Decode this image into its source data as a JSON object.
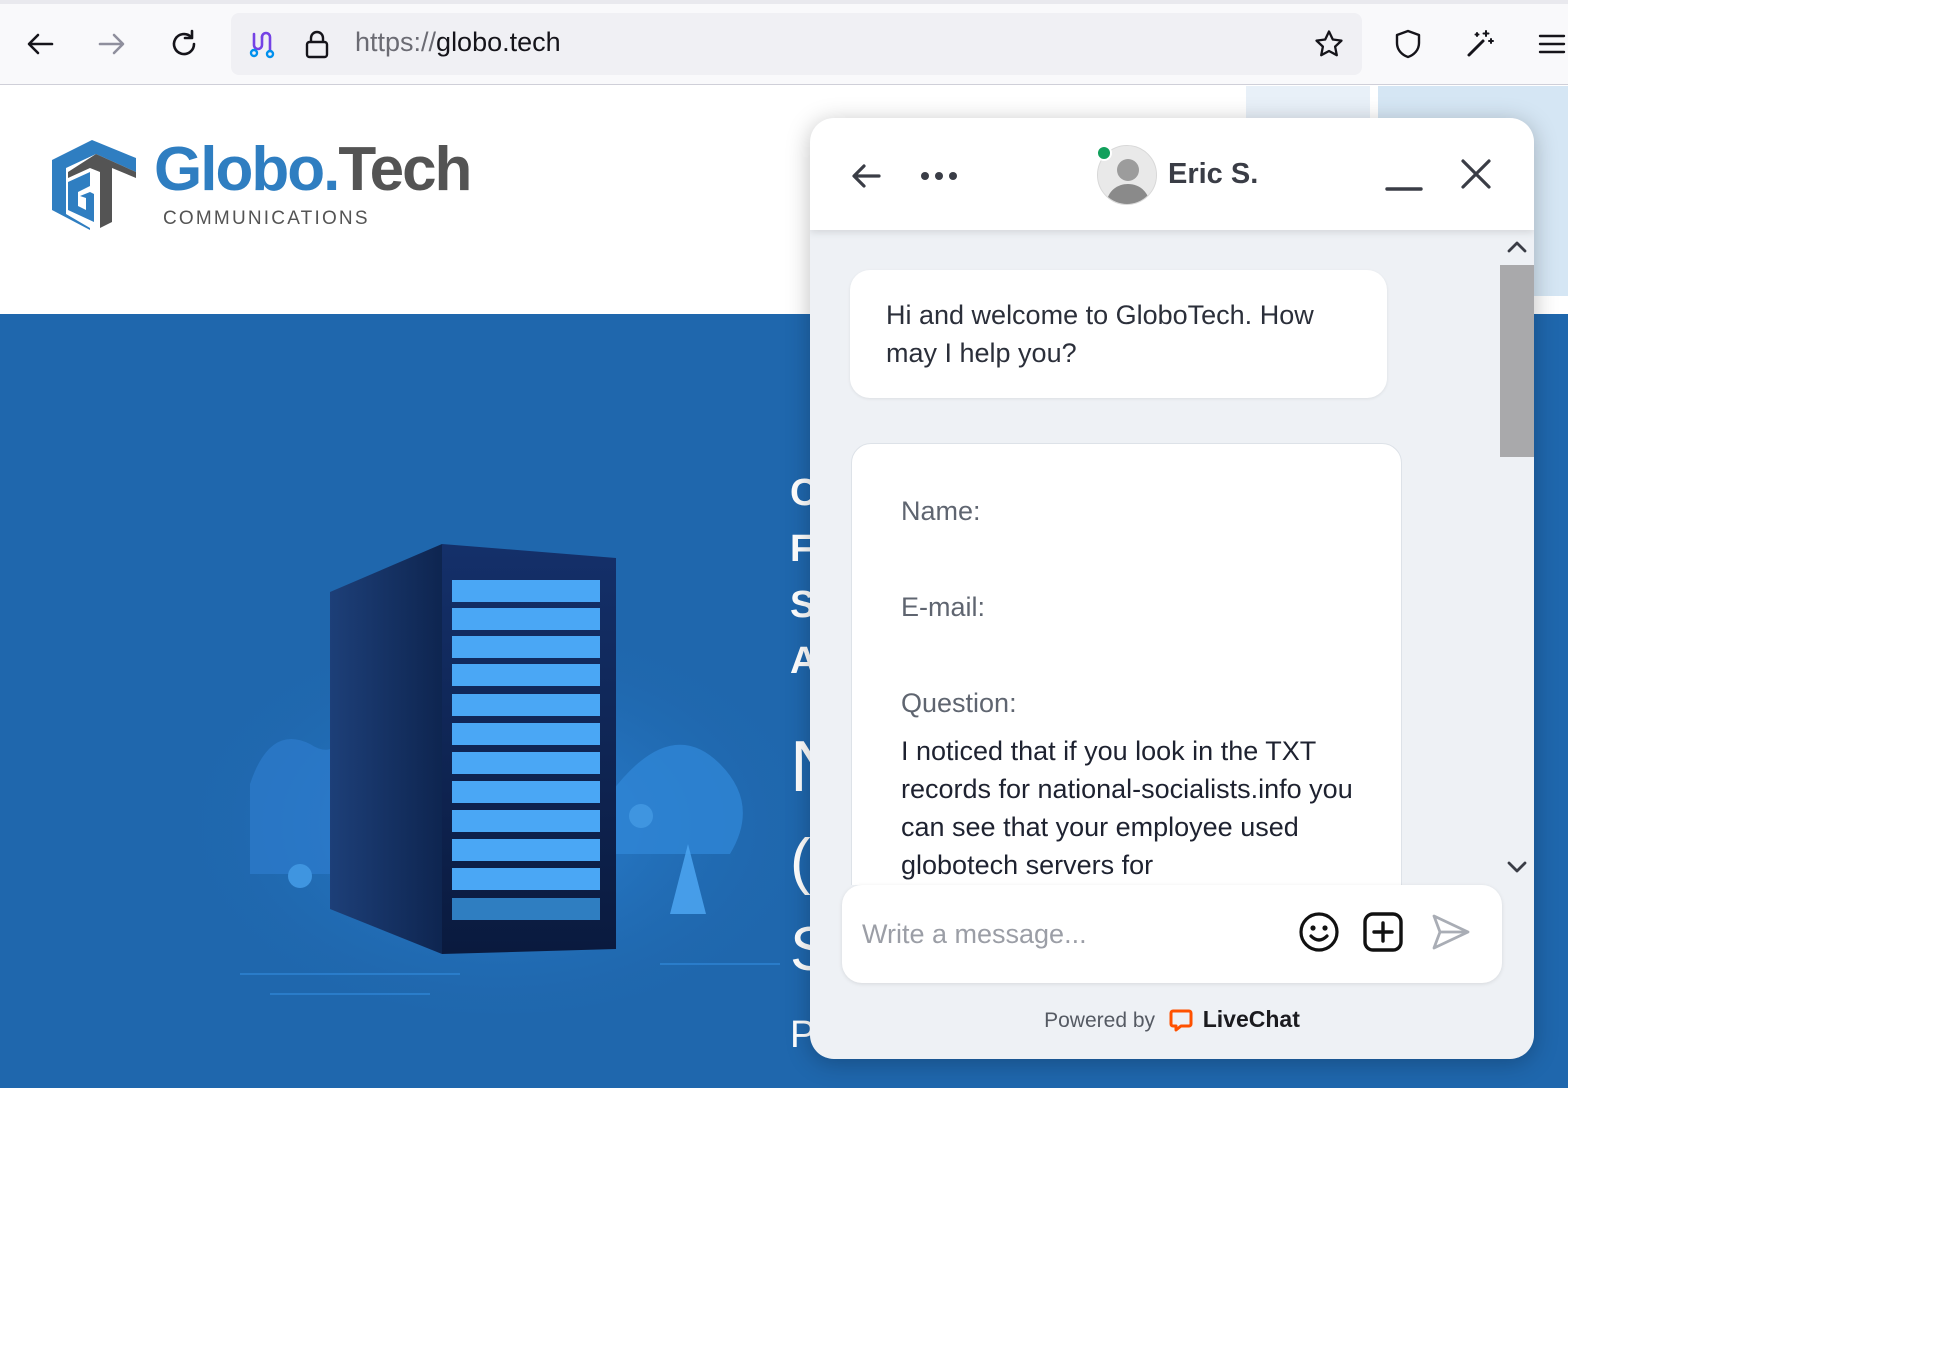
{
  "browser": {
    "url_scheme": "https://",
    "url_host": "globo.tech"
  },
  "site": {
    "logo": {
      "word_globo": "Globo",
      "word_dot": ".",
      "word_tech": "Tech",
      "subtitle": "COMMUNICATIONS"
    },
    "hero_fragments": [
      "C",
      "F",
      "S",
      "A",
      "N",
      "(",
      "S",
      "P"
    ]
  },
  "chat": {
    "agent_name": "Eric S.",
    "agent_status": "online",
    "welcome_message": "Hi and welcome to GloboTech. How may I help you?",
    "form": {
      "name_label": "Name:",
      "email_label": "E-mail:",
      "question_label": "Question:",
      "question_text": "I noticed that if you look in the TXT records for national-socialists.info you can see that your employee used globotech servers for"
    },
    "composer": {
      "placeholder": "Write a message..."
    },
    "powered_by": "Powered by",
    "brand": "LiveChat",
    "colors": {
      "online": "#12a05c",
      "brand_orange": "#ff5100",
      "site_blue": "#1f67ad"
    }
  }
}
